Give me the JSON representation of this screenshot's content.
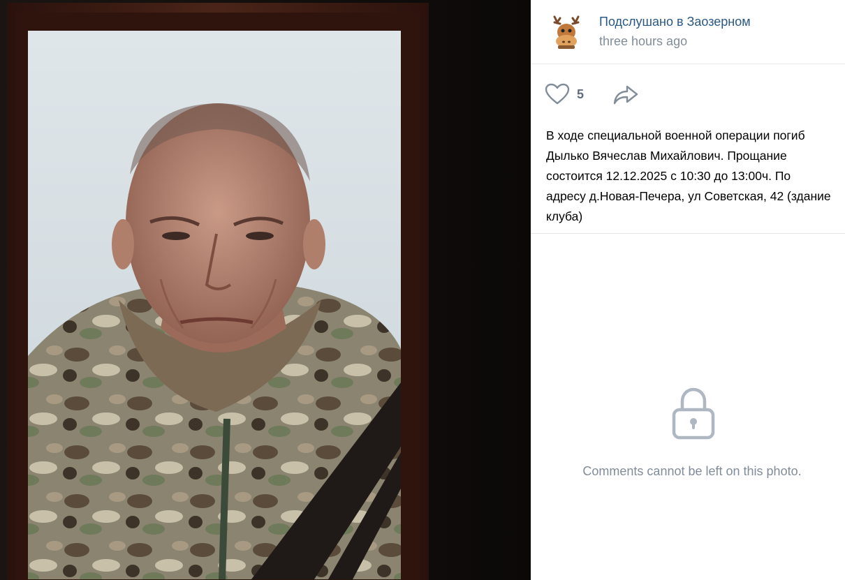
{
  "group": {
    "name": "Подслушано в Заозерном",
    "time": "three hours ago",
    "avatar_icon": "moose-icon"
  },
  "actions": {
    "like_count": "5",
    "like_icon": "heart-icon",
    "share_icon": "share-arrow-icon"
  },
  "post": {
    "text": "В ходе специальной военной операции погиб Дылько Вячеслав Михайлович. Прощание состоится 12.12.2025 с 10:30 до 13:00ч. По адресу д.Новая-Печера, ул Советская, 42 (здание клуба)"
  },
  "comments": {
    "disabled_text": "Comments cannot be left on this photo.",
    "lock_icon": "lock-icon"
  },
  "colors": {
    "link": "#2a5885",
    "muted": "#818c99",
    "frame": "#3a1a12",
    "mourning_ribbon": "#1f1a17"
  }
}
